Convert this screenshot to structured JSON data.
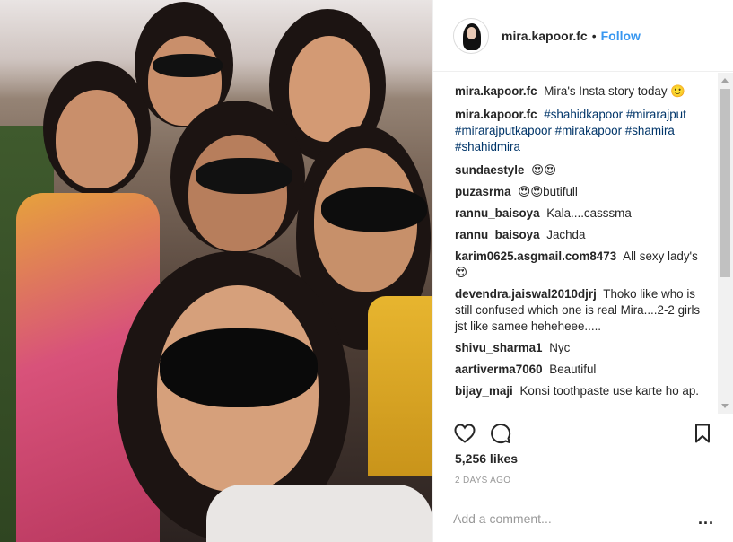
{
  "post": {
    "username": "mira.kapoor.fc",
    "separator": "•",
    "follow_label": "Follow",
    "likes": "5,256 likes",
    "timestamp": "2 DAYS AGO",
    "add_comment_placeholder": "Add a comment...",
    "more_label": "..."
  },
  "comments": [
    {
      "user": "mira.kapoor.fc",
      "text": "Mira's Insta story today 🙂"
    },
    {
      "user": "mira.kapoor.fc",
      "text": "#shahidkapoor #mirarajput #mirarajputkapoor #mirakapoor #shamira #shahidmira"
    },
    {
      "user": "sundaestyle",
      "text": "😍😍"
    },
    {
      "user": "puzasrma",
      "text": "😍😍butifull"
    },
    {
      "user": "rannu_baisoya",
      "text": "Kala....casssma"
    },
    {
      "user": "rannu_baisoya",
      "text": "Jachda"
    },
    {
      "user": "karim0625.asgmail.com8473",
      "text": "All sexy lady's 😍"
    },
    {
      "user": "devendra.jaiswal2010djrj",
      "text": "Thoko like who is still confused which one is real Mira....2-2 girls jst like samee heheheee....."
    },
    {
      "user": "shivu_sharma1",
      "text": "Nyc"
    },
    {
      "user": "aartiverma7060",
      "text": "Beautiful"
    },
    {
      "user": "bijay_maji",
      "text": "Konsi toothpaste use karte ho ap."
    }
  ],
  "icons": {
    "like": "heart-icon",
    "comment": "comment-icon",
    "save": "bookmark-icon",
    "more": "more-options-icon"
  },
  "colors": {
    "follow": "#3897f0",
    "hashtag": "#003569",
    "muted": "#999999",
    "text": "#262626"
  }
}
